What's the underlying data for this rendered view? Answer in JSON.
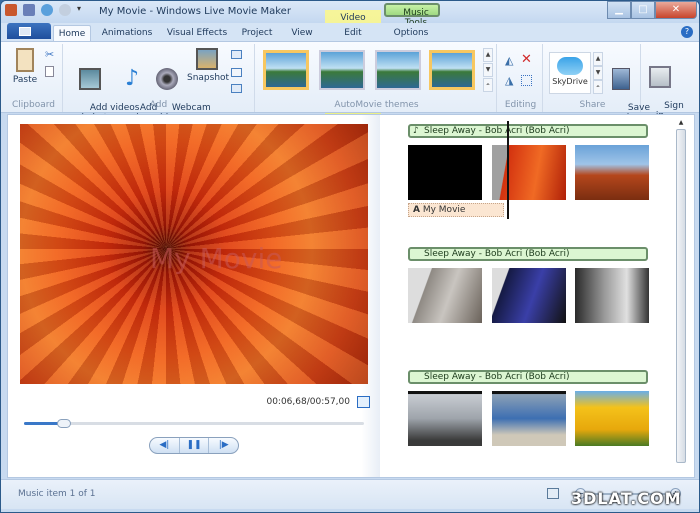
{
  "window": {
    "title": "My Movie - Windows Live Movie Maker"
  },
  "context_tabs": [
    {
      "label": "Video Tools"
    },
    {
      "label": "Music Tools"
    }
  ],
  "tabs": [
    {
      "label": "Home",
      "active": true
    },
    {
      "label": "Animations"
    },
    {
      "label": "Visual Effects"
    },
    {
      "label": "Project"
    },
    {
      "label": "View"
    },
    {
      "label": "Edit"
    },
    {
      "label": "Options"
    }
  ],
  "ribbon": {
    "clipboard": {
      "label": "Clipboard",
      "paste": "Paste"
    },
    "add": {
      "label": "Add",
      "add_videos": "Add videos\nand photos",
      "add_music": "Add\nmusic",
      "webcam": "Webcam\nvideo",
      "snapshot": "Snapshot"
    },
    "themes": {
      "label": "AutoMovie themes",
      "count": 4
    },
    "editing": {
      "label": "Editing"
    },
    "share": {
      "label": "Share",
      "skydrive": "SkyDrive",
      "save_movie": "Save\nmovie"
    },
    "sign_in": "Sign\nin"
  },
  "preview": {
    "watermark": "My Movie",
    "time": "00:06,68/00:57,00",
    "progress_fraction": 0.117
  },
  "storyboard": {
    "tracks": [
      {
        "music": "Sleep Away - Bob Acri (Bob Acri)",
        "caption": "My Movie",
        "clips": [
          "black-title",
          "flower",
          "desert"
        ]
      },
      {
        "music": "Sleep Away - Bob Acri (Bob Acri)",
        "clips": [
          "koala",
          "softonic",
          "barcelona"
        ]
      },
      {
        "music": "Sleep Away - Bob Acri (Bob Acri)",
        "clips": [
          "chair",
          "classroom",
          "tulips"
        ]
      }
    ]
  },
  "status": {
    "text": "Music item 1 of 1"
  },
  "watermark": "3DLAT.COM"
}
